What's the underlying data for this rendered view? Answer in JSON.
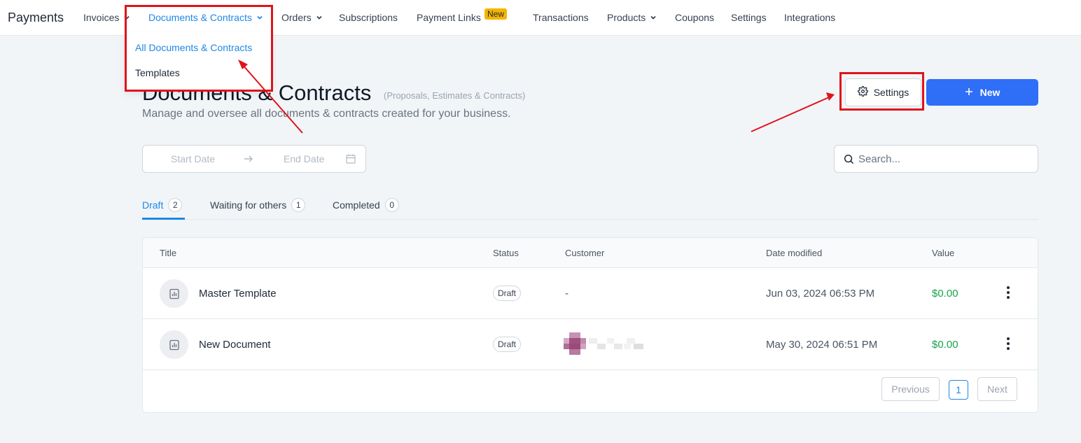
{
  "app": {
    "brand": "Payments"
  },
  "nav": {
    "items": [
      {
        "label": "Invoices",
        "has_dropdown": true
      },
      {
        "label": "Documents & Contracts",
        "has_dropdown": true,
        "active": true
      },
      {
        "label": "Orders",
        "has_dropdown": true
      },
      {
        "label": "Subscriptions"
      },
      {
        "label": "Payment Links",
        "badge": "New"
      },
      {
        "label": "Transactions"
      },
      {
        "label": "Products",
        "has_dropdown": true
      },
      {
        "label": "Coupons"
      },
      {
        "label": "Settings"
      },
      {
        "label": "Integrations"
      }
    ]
  },
  "dropdown": {
    "items": [
      {
        "label": "All Documents & Contracts",
        "active": true
      },
      {
        "label": "Templates"
      }
    ]
  },
  "header": {
    "title": "Documents & Contracts",
    "title_note": "(Proposals, Estimates & Contracts)",
    "description": "Manage and oversee all documents & contracts created for your business.",
    "settings_label": "Settings",
    "new_label": "New"
  },
  "filters": {
    "start_date_placeholder": "Start Date",
    "end_date_placeholder": "End Date",
    "search_placeholder": "Search..."
  },
  "tabs": [
    {
      "label": "Draft",
      "count": "2",
      "active": true
    },
    {
      "label": "Waiting for others",
      "count": "1"
    },
    {
      "label": "Completed",
      "count": "0"
    }
  ],
  "table": {
    "columns": [
      "Title",
      "Status",
      "Customer",
      "Date modified",
      "Value"
    ],
    "rows": [
      {
        "title": "Master Template",
        "status": "Draft",
        "customer": "-",
        "date": "Jun 03, 2024 06:53 PM",
        "value": "$0.00"
      },
      {
        "title": "New Document",
        "status": "Draft",
        "customer": "",
        "customer_redacted": true,
        "date": "May 30, 2024 06:51 PM",
        "value": "$0.00"
      }
    ]
  },
  "pagination": {
    "previous": "Previous",
    "current": "1",
    "next": "Next"
  },
  "colors": {
    "accent": "#1e88e5",
    "primary_button": "#2f6ef7",
    "annotation": "#e0131a",
    "value_green": "#16a34a",
    "badge_yellow": "#f5b400"
  }
}
